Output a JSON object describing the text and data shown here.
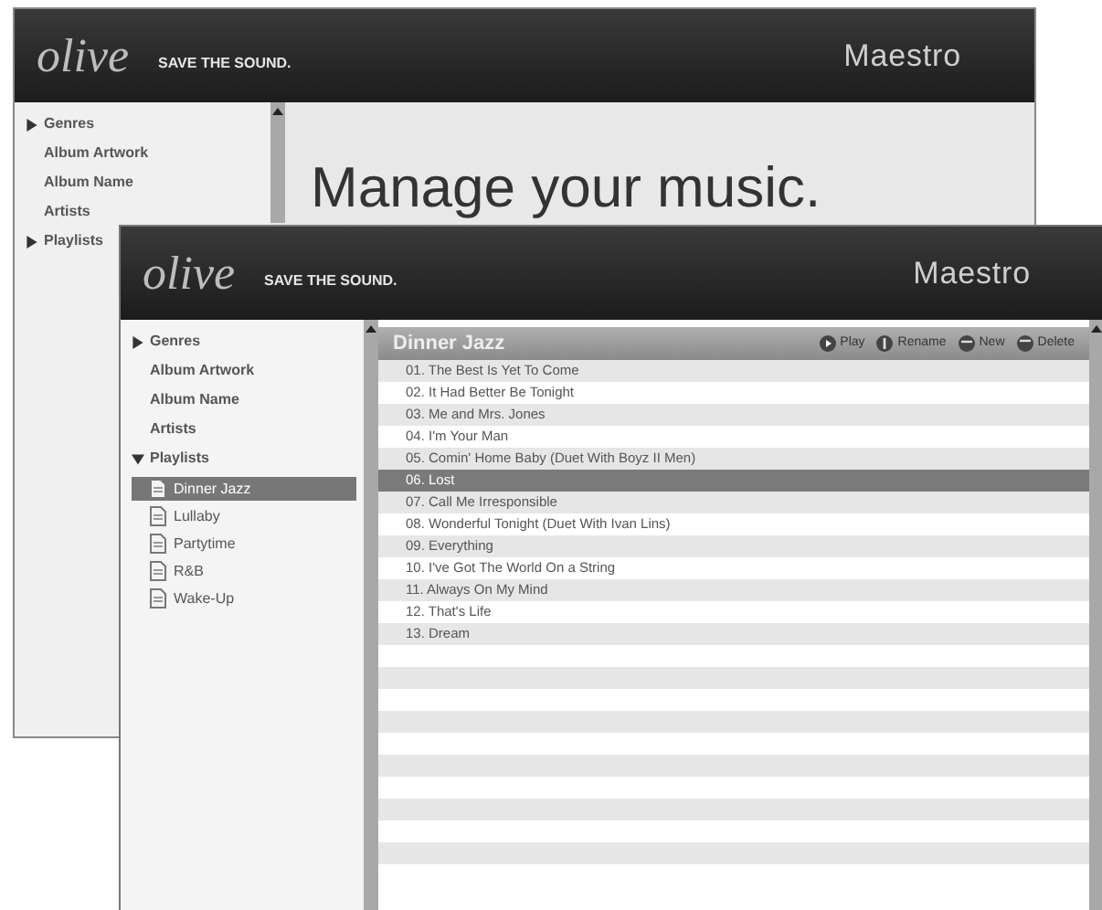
{
  "back_window": {
    "logo": "olive",
    "tagline": "SAVE THE SOUND.",
    "title": "Maestro",
    "sidebar": {
      "items": [
        {
          "label": "Genres",
          "kind": "group",
          "expanded": false
        },
        {
          "label": "Album Artwork",
          "kind": "link"
        },
        {
          "label": "Album Name",
          "kind": "link"
        },
        {
          "label": "Artists",
          "kind": "link"
        },
        {
          "label": "Playlists",
          "kind": "group",
          "expanded": false
        }
      ]
    },
    "headline": "Manage your music."
  },
  "front_window": {
    "logo": "olive",
    "tagline": "SAVE THE SOUND.",
    "title": "Maestro",
    "sidebar": {
      "items": [
        {
          "label": "Genres",
          "kind": "group",
          "expanded": false
        },
        {
          "label": "Album Artwork",
          "kind": "link"
        },
        {
          "label": "Album Name",
          "kind": "link"
        },
        {
          "label": "Artists",
          "kind": "link"
        },
        {
          "label": "Playlists",
          "kind": "group",
          "expanded": true,
          "children": [
            {
              "label": "Dinner Jazz",
              "selected": true
            },
            {
              "label": "Lullaby",
              "selected": false
            },
            {
              "label": "Partytime",
              "selected": false
            },
            {
              "label": "R&B",
              "selected": false
            },
            {
              "label": "Wake-Up",
              "selected": false
            }
          ]
        }
      ]
    },
    "playlist": {
      "title": "Dinner Jazz",
      "actions": [
        {
          "label": "Play",
          "kind": "play"
        },
        {
          "label": "Rename",
          "kind": "rename"
        },
        {
          "label": "New",
          "kind": "new"
        },
        {
          "label": "Delete",
          "kind": "delete"
        }
      ],
      "tracks": [
        {
          "label": "01. The Best Is Yet To Come",
          "selected": false
        },
        {
          "label": "02. It Had Better Be Tonight",
          "selected": false
        },
        {
          "label": "03. Me and Mrs. Jones",
          "selected": false
        },
        {
          "label": "04. I'm Your Man",
          "selected": false
        },
        {
          "label": "05. Comin' Home Baby (Duet With Boyz II Men)",
          "selected": false
        },
        {
          "label": "06. Lost",
          "selected": true
        },
        {
          "label": "07. Call Me Irresponsible",
          "selected": false
        },
        {
          "label": "08. Wonderful Tonight (Duet With Ivan Lins)",
          "selected": false
        },
        {
          "label": "09. Everything",
          "selected": false
        },
        {
          "label": "10. I've Got The World On a String",
          "selected": false
        },
        {
          "label": "11. Always On My Mind",
          "selected": false
        },
        {
          "label": "12. That's Life",
          "selected": false
        },
        {
          "label": "13. Dream",
          "selected": false
        }
      ]
    }
  }
}
